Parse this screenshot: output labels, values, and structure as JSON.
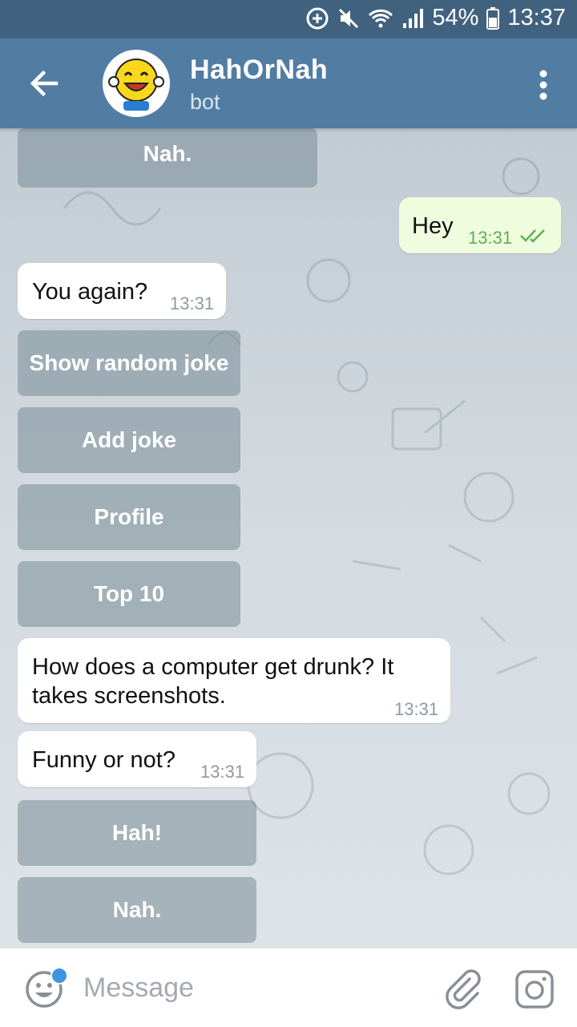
{
  "status_bar": {
    "battery_percent": "54%",
    "time": "13:37"
  },
  "header": {
    "title": "HahOrNah",
    "subtitle": "bot"
  },
  "messages": {
    "top_button": "Nah.",
    "out1": {
      "text": "Hey",
      "time": "13:31"
    },
    "in1": {
      "text": "You again?",
      "time": "13:31"
    },
    "menu_buttons": [
      "Show random joke",
      "Add joke",
      "Profile",
      "Top 10"
    ],
    "in2": {
      "line1": "How does a computer get drunk? It",
      "line2": "takes screenshots.",
      "time": "13:31"
    },
    "in3": {
      "text": "Funny or not?",
      "time": "13:31"
    },
    "vote_buttons": [
      "Hah!",
      "Nah."
    ]
  },
  "input": {
    "placeholder": "Message"
  },
  "colors": {
    "header": "#527da3",
    "statusbar": "#40627f",
    "outgoing": "#effdde",
    "accent_dot": "#3e95e0"
  }
}
